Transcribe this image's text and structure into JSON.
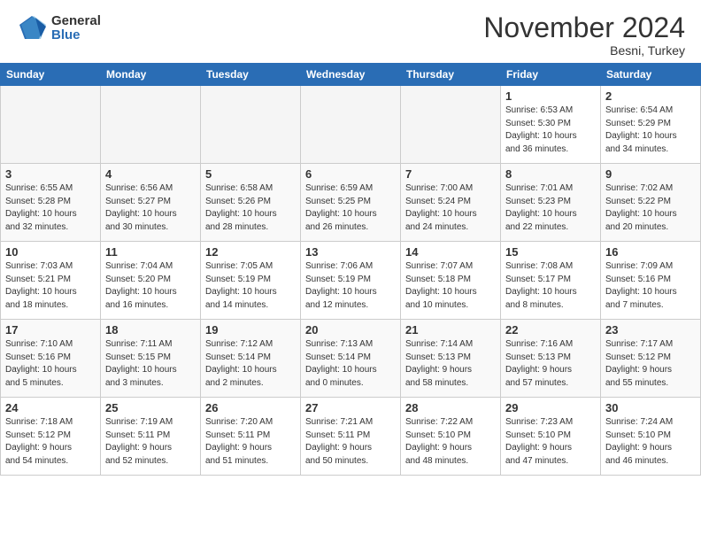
{
  "header": {
    "logo_general": "General",
    "logo_blue": "Blue",
    "month_title": "November 2024",
    "location": "Besni, Turkey"
  },
  "weekdays": [
    "Sunday",
    "Monday",
    "Tuesday",
    "Wednesday",
    "Thursday",
    "Friday",
    "Saturday"
  ],
  "weeks": [
    [
      {
        "day": "",
        "info": ""
      },
      {
        "day": "",
        "info": ""
      },
      {
        "day": "",
        "info": ""
      },
      {
        "day": "",
        "info": ""
      },
      {
        "day": "",
        "info": ""
      },
      {
        "day": "1",
        "info": "Sunrise: 6:53 AM\nSunset: 5:30 PM\nDaylight: 10 hours\nand 36 minutes."
      },
      {
        "day": "2",
        "info": "Sunrise: 6:54 AM\nSunset: 5:29 PM\nDaylight: 10 hours\nand 34 minutes."
      }
    ],
    [
      {
        "day": "3",
        "info": "Sunrise: 6:55 AM\nSunset: 5:28 PM\nDaylight: 10 hours\nand 32 minutes."
      },
      {
        "day": "4",
        "info": "Sunrise: 6:56 AM\nSunset: 5:27 PM\nDaylight: 10 hours\nand 30 minutes."
      },
      {
        "day": "5",
        "info": "Sunrise: 6:58 AM\nSunset: 5:26 PM\nDaylight: 10 hours\nand 28 minutes."
      },
      {
        "day": "6",
        "info": "Sunrise: 6:59 AM\nSunset: 5:25 PM\nDaylight: 10 hours\nand 26 minutes."
      },
      {
        "day": "7",
        "info": "Sunrise: 7:00 AM\nSunset: 5:24 PM\nDaylight: 10 hours\nand 24 minutes."
      },
      {
        "day": "8",
        "info": "Sunrise: 7:01 AM\nSunset: 5:23 PM\nDaylight: 10 hours\nand 22 minutes."
      },
      {
        "day": "9",
        "info": "Sunrise: 7:02 AM\nSunset: 5:22 PM\nDaylight: 10 hours\nand 20 minutes."
      }
    ],
    [
      {
        "day": "10",
        "info": "Sunrise: 7:03 AM\nSunset: 5:21 PM\nDaylight: 10 hours\nand 18 minutes."
      },
      {
        "day": "11",
        "info": "Sunrise: 7:04 AM\nSunset: 5:20 PM\nDaylight: 10 hours\nand 16 minutes."
      },
      {
        "day": "12",
        "info": "Sunrise: 7:05 AM\nSunset: 5:19 PM\nDaylight: 10 hours\nand 14 minutes."
      },
      {
        "day": "13",
        "info": "Sunrise: 7:06 AM\nSunset: 5:19 PM\nDaylight: 10 hours\nand 12 minutes."
      },
      {
        "day": "14",
        "info": "Sunrise: 7:07 AM\nSunset: 5:18 PM\nDaylight: 10 hours\nand 10 minutes."
      },
      {
        "day": "15",
        "info": "Sunrise: 7:08 AM\nSunset: 5:17 PM\nDaylight: 10 hours\nand 8 minutes."
      },
      {
        "day": "16",
        "info": "Sunrise: 7:09 AM\nSunset: 5:16 PM\nDaylight: 10 hours\nand 7 minutes."
      }
    ],
    [
      {
        "day": "17",
        "info": "Sunrise: 7:10 AM\nSunset: 5:16 PM\nDaylight: 10 hours\nand 5 minutes."
      },
      {
        "day": "18",
        "info": "Sunrise: 7:11 AM\nSunset: 5:15 PM\nDaylight: 10 hours\nand 3 minutes."
      },
      {
        "day": "19",
        "info": "Sunrise: 7:12 AM\nSunset: 5:14 PM\nDaylight: 10 hours\nand 2 minutes."
      },
      {
        "day": "20",
        "info": "Sunrise: 7:13 AM\nSunset: 5:14 PM\nDaylight: 10 hours\nand 0 minutes."
      },
      {
        "day": "21",
        "info": "Sunrise: 7:14 AM\nSunset: 5:13 PM\nDaylight: 9 hours\nand 58 minutes."
      },
      {
        "day": "22",
        "info": "Sunrise: 7:16 AM\nSunset: 5:13 PM\nDaylight: 9 hours\nand 57 minutes."
      },
      {
        "day": "23",
        "info": "Sunrise: 7:17 AM\nSunset: 5:12 PM\nDaylight: 9 hours\nand 55 minutes."
      }
    ],
    [
      {
        "day": "24",
        "info": "Sunrise: 7:18 AM\nSunset: 5:12 PM\nDaylight: 9 hours\nand 54 minutes."
      },
      {
        "day": "25",
        "info": "Sunrise: 7:19 AM\nSunset: 5:11 PM\nDaylight: 9 hours\nand 52 minutes."
      },
      {
        "day": "26",
        "info": "Sunrise: 7:20 AM\nSunset: 5:11 PM\nDaylight: 9 hours\nand 51 minutes."
      },
      {
        "day": "27",
        "info": "Sunrise: 7:21 AM\nSunset: 5:11 PM\nDaylight: 9 hours\nand 50 minutes."
      },
      {
        "day": "28",
        "info": "Sunrise: 7:22 AM\nSunset: 5:10 PM\nDaylight: 9 hours\nand 48 minutes."
      },
      {
        "day": "29",
        "info": "Sunrise: 7:23 AM\nSunset: 5:10 PM\nDaylight: 9 hours\nand 47 minutes."
      },
      {
        "day": "30",
        "info": "Sunrise: 7:24 AM\nSunset: 5:10 PM\nDaylight: 9 hours\nand 46 minutes."
      }
    ]
  ]
}
